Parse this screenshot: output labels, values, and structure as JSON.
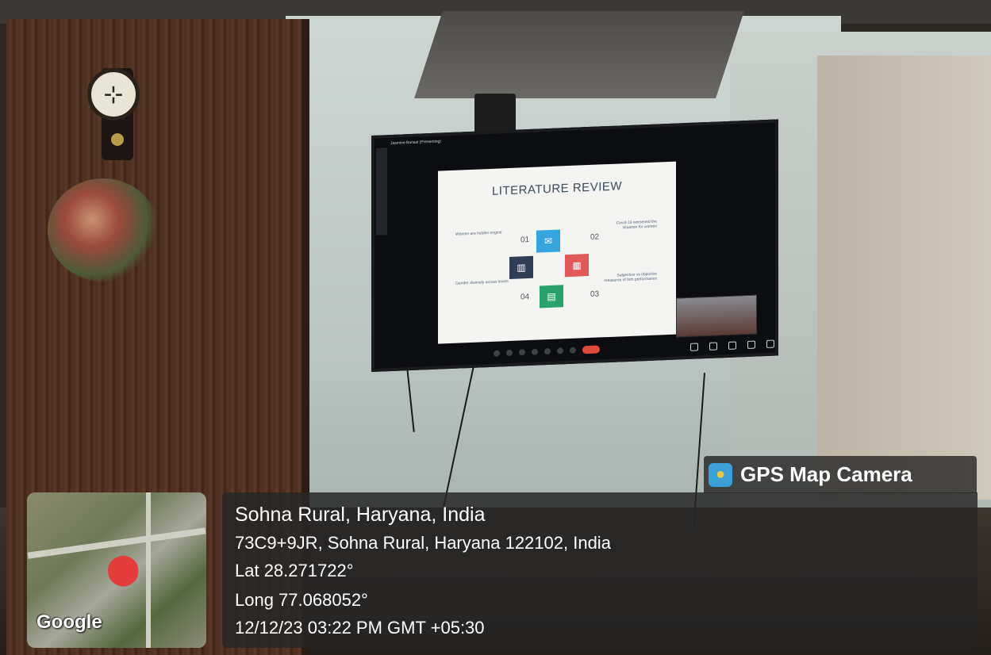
{
  "tv_screen": {
    "presenter_label": "Jasmine Bansal (Presenting)",
    "slide_title": "LITERATURE REVIEW",
    "numbers": [
      "01",
      "02",
      "03",
      "04"
    ],
    "left_top_text": "Women are hidden engine",
    "right_top_text": "Covid-19 worsened the situation for women",
    "left_bottom_text": "Gender diversity across levels",
    "right_bottom_text": "Subjective vs objective measures of firm performance"
  },
  "gps_overlay": {
    "badge": {
      "icon": "map-pin-icon",
      "title": "GPS Map Camera"
    },
    "map": {
      "pin_icon": "map-marker-icon",
      "watermark": "Google"
    },
    "place": "Sohna Rural, Haryana, India",
    "address": "73C9+9JR, Sohna Rural, Haryana 122102, India",
    "latitude": "Lat 28.271722°",
    "longitude": "Long 77.068052°",
    "timestamp": "12/12/23 03:22 PM GMT +05:30"
  }
}
